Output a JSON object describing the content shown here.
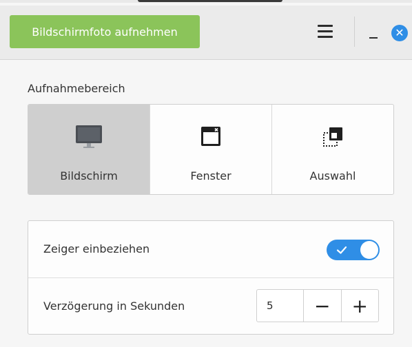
{
  "header": {
    "capture_button": "Bildschirmfoto aufnehmen",
    "icons": [
      "hamburger-menu-icon",
      "minimize-icon",
      "close-icon"
    ],
    "accent_color": "#2f8ee6",
    "capture_color": "#8bc45a"
  },
  "capture_area": {
    "label": "Aufnahmebereich",
    "options": [
      {
        "label": "Bildschirm",
        "icon": "monitor-icon",
        "selected": true
      },
      {
        "label": "Fenster",
        "icon": "window-icon",
        "selected": false
      },
      {
        "label": "Auswahl",
        "icon": "selection-icon",
        "selected": false
      }
    ]
  },
  "settings": {
    "include_pointer": {
      "label": "Zeiger einbeziehen",
      "enabled": true
    },
    "delay": {
      "label": "Verzögerung in Sekunden",
      "value": "5",
      "decrement": "−",
      "increment": "+"
    }
  }
}
